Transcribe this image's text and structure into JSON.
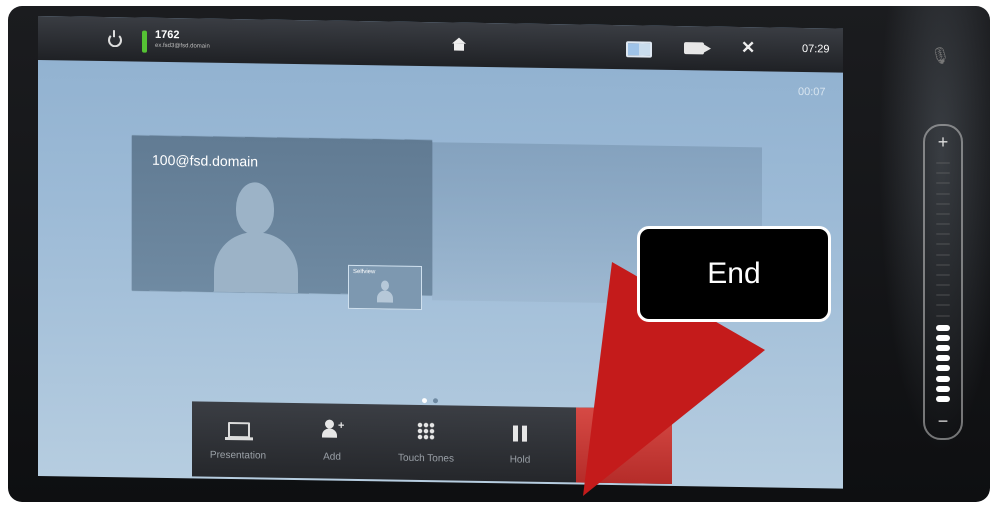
{
  "status_bar": {
    "call_number": "1762",
    "call_address": "ex.fsd3@fsd.domain",
    "clock": "07:29"
  },
  "call": {
    "timer": "00:07",
    "remote_name": "100@fsd.domain",
    "selfview_label": "Selfview"
  },
  "page_indicator": {
    "count": 2,
    "active": 0
  },
  "toolbar": {
    "presentation_label": "Presentation",
    "add_label": "Add",
    "touch_tones_label": "Touch Tones",
    "hold_label": "Hold"
  },
  "volume": {
    "plus_label": "+",
    "minus_label": "−",
    "level": 0.33,
    "segments_total": 24
  },
  "annotation": {
    "label": "End",
    "arrow_color": "#c41b1b"
  },
  "icons": [
    "power-icon",
    "home-icon",
    "layout-icon",
    "camera-icon",
    "tools-icon",
    "mic-mute-icon",
    "laptop-icon",
    "add-user-icon",
    "keypad-icon",
    "pause-icon"
  ],
  "colors": {
    "end_button": "#c9403c",
    "status_led": "#55c234",
    "volume_active": "#ffffff"
  }
}
